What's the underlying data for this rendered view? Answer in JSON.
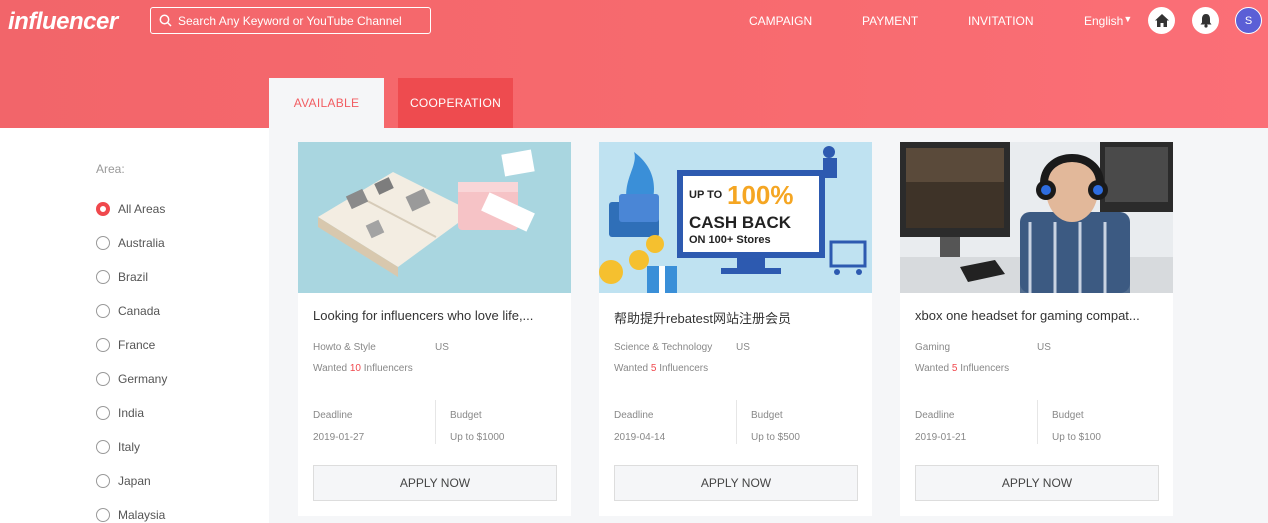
{
  "header": {
    "logo": "influencer",
    "search_placeholder": "Search Any Keyword or YouTube Channel",
    "nav": [
      "CAMPAIGN",
      "PAYMENT",
      "INVITATION"
    ],
    "language": "English",
    "avatar_initial": "S"
  },
  "tabs": {
    "available": "AVAILABLE",
    "cooperation": "COOPERATION"
  },
  "sidebar": {
    "label": "Area:",
    "areas": [
      "All Areas",
      "Australia",
      "Brazil",
      "Canada",
      "France",
      "Germany",
      "India",
      "Italy",
      "Japan",
      "Malaysia"
    ],
    "selected": "All Areas"
  },
  "cards": [
    {
      "title": "Looking for influencers who love life,...",
      "category": "Howto & Style",
      "country": "US",
      "wanted_prefix": "Wanted ",
      "wanted_count": "10",
      "wanted_suffix": " Influencers",
      "deadline_label": "Deadline",
      "deadline": "2019-01-27",
      "budget_label": "Budget",
      "budget": "Up to $1000",
      "button": "APPLY NOW"
    },
    {
      "title": "帮助提升rebatest网站注册会员",
      "category": "Science & Technology",
      "country": "US",
      "wanted_prefix": "Wanted ",
      "wanted_count": "5",
      "wanted_suffix": " Influencers",
      "deadline_label": "Deadline",
      "deadline": "2019-04-14",
      "budget_label": "Budget",
      "budget": "Up to $500",
      "button": "APPLY NOW",
      "banner": {
        "line1": "UP TO",
        "line2": "100%",
        "line3": "CASH BACK",
        "line4": "ON 100+ Stores"
      }
    },
    {
      "title": "xbox one headset for gaming compat...",
      "category": "Gaming",
      "country": "US",
      "wanted_prefix": "Wanted ",
      "wanted_count": "5",
      "wanted_suffix": " Influencers",
      "deadline_label": "Deadline",
      "deadline": "2019-01-21",
      "budget_label": "Budget",
      "budget": "Up to $100",
      "button": "APPLY NOW"
    }
  ],
  "colors": {
    "brand": "#f76a6e",
    "accent": "#f0484d",
    "avatar": "#5b5fd6"
  }
}
